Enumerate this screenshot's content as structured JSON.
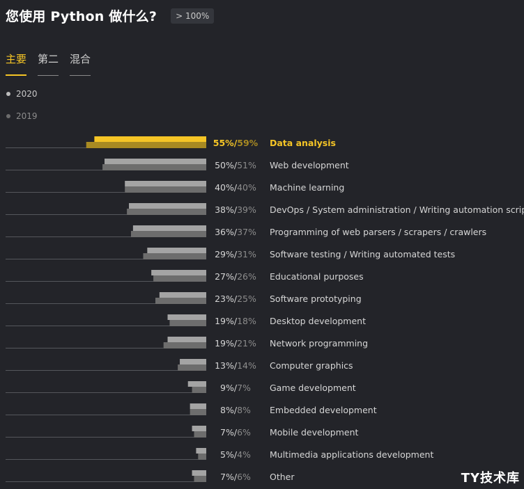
{
  "header": {
    "title": "您使用 Python 做什么?",
    "badge": "> 100%"
  },
  "tabs": [
    {
      "label": "主要",
      "active": true
    },
    {
      "label": "第二",
      "active": false
    },
    {
      "label": "混合",
      "active": false
    }
  ],
  "colors": {
    "highlight": "#f5c526",
    "highlight_dark": "#a88a22",
    "bar_2020": "#a4a4a4",
    "bar_2019": "#6d6d6d",
    "text": "#d6d6d6"
  },
  "chart_data": {
    "type": "bar",
    "orientation": "horizontal",
    "legend": [
      "2020",
      "2019"
    ],
    "categories": [
      "Data analysis",
      "Web development",
      "Machine learning",
      "DevOps / System administration / Writing automation scripts",
      "Programming of web parsers / scrapers / crawlers",
      "Software testing / Writing automated tests",
      "Educational purposes",
      "Software prototyping",
      "Desktop development",
      "Network programming",
      "Computer graphics",
      "Game development",
      "Embedded development",
      "Mobile development",
      "Multimedia applications development",
      "Other"
    ],
    "series": [
      {
        "name": "2020",
        "values": [
          55,
          50,
          40,
          38,
          36,
          29,
          27,
          23,
          19,
          19,
          13,
          9,
          8,
          7,
          5,
          7
        ]
      },
      {
        "name": "2019",
        "values": [
          59,
          51,
          40,
          39,
          37,
          31,
          26,
          25,
          18,
          21,
          14,
          7,
          8,
          6,
          4,
          6
        ]
      }
    ],
    "xlim": [
      0,
      100
    ],
    "highlight_index": 0
  },
  "watermark": "TY技术库"
}
